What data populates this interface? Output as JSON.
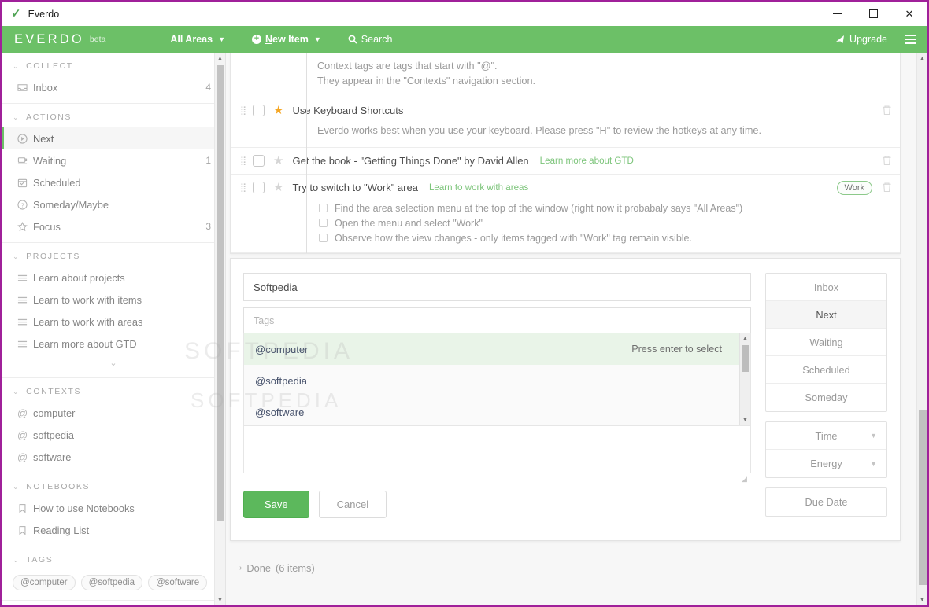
{
  "window": {
    "title": "Everdo",
    "check_icon": "✓",
    "minimize": "minimize-icon",
    "maximize": "maximize-icon",
    "close": "✕"
  },
  "appbar": {
    "brand": "EVERDO",
    "beta": "beta",
    "areas_label": "All Areas",
    "new_item_label": "New Item",
    "search_label": "Search",
    "upgrade_label": "Upgrade",
    "menu_icon": "hamburger-icon",
    "caret": "▼",
    "plus": "+",
    "search_icon": "🔍",
    "rocket_icon": "➤",
    "color": "#6cc067"
  },
  "sidebar": {
    "groups": [
      {
        "title": "COLLECT",
        "items": [
          {
            "label": "Inbox",
            "icon": "inbox-icon",
            "count": "4",
            "active": false
          }
        ]
      },
      {
        "title": "ACTIONS",
        "items": [
          {
            "label": "Next",
            "icon": "next-arrow-icon",
            "count": "",
            "active": true
          },
          {
            "label": "Waiting",
            "icon": "waiting-icon",
            "count": "1",
            "active": false
          },
          {
            "label": "Scheduled",
            "icon": "calendar-icon",
            "count": "",
            "active": false
          },
          {
            "label": "Someday/Maybe",
            "icon": "question-icon",
            "count": "",
            "active": false
          },
          {
            "label": "Focus",
            "icon": "star-icon",
            "count": "3",
            "active": false
          }
        ]
      },
      {
        "title": "PROJECTS",
        "items": [
          {
            "label": "Learn about projects",
            "icon": "list-icon",
            "count": "",
            "active": false
          },
          {
            "label": "Learn to work with items",
            "icon": "list-icon",
            "count": "",
            "active": false
          },
          {
            "label": "Learn to work with areas",
            "icon": "list-icon",
            "count": "",
            "active": false
          },
          {
            "label": "Learn more about GTD",
            "icon": "list-icon",
            "count": "",
            "active": false
          }
        ],
        "expand_icon": "chevron-down-icon"
      },
      {
        "title": "CONTEXTS",
        "items": [
          {
            "label": "computer",
            "icon": "at-icon",
            "count": "",
            "active": false
          },
          {
            "label": "softpedia",
            "icon": "at-icon",
            "count": "",
            "active": false
          },
          {
            "label": "software",
            "icon": "at-icon",
            "count": "",
            "active": false
          }
        ]
      },
      {
        "title": "NOTEBOOKS",
        "items": [
          {
            "label": "How to use Notebooks",
            "icon": "bookmark-icon",
            "count": "",
            "active": false
          },
          {
            "label": "Reading List",
            "icon": "bookmark-icon",
            "count": "",
            "active": false
          }
        ]
      },
      {
        "title": "TAGS",
        "chips": [
          "@computer",
          "@softpedia",
          "@software"
        ]
      }
    ]
  },
  "list": {
    "top_note": {
      "lines": [
        "Context tags are tags that start with \"@\".",
        "They appear in the \"Contexts\" navigation section."
      ]
    },
    "tasks": [
      {
        "title": "Use Keyboard Shortcuts",
        "starred": true,
        "link": "",
        "badge": "",
        "description": "Everdo works best when you use your keyboard. Please press \"H\" to review the hotkeys at any time.",
        "subtasks": []
      },
      {
        "title": "Get the book - \"Getting Things Done\" by David Allen",
        "starred": false,
        "link": "Learn more about GTD",
        "badge": "",
        "description": "",
        "subtasks": []
      },
      {
        "title": "Try to switch to \"Work\" area",
        "starred": false,
        "link": "Learn to work with areas",
        "badge": "Work",
        "description": "",
        "subtasks": [
          "Find the area selection menu at the top of the window (right now it probabaly says \"All Areas\")",
          "Open the menu and select \"Work\"",
          "Observe how the view changes - only items tagged with \"Work\" tag remain visible."
        ]
      }
    ],
    "done": {
      "label": "Done",
      "count": "(6 items)",
      "chevron": "›"
    }
  },
  "editor": {
    "title_value": "Softpedia",
    "title_placeholder": "",
    "tags_value": "",
    "tags_placeholder": "Tags",
    "note_value": "",
    "suggestions": [
      {
        "label": "@computer",
        "hint": "Press enter to select",
        "selected": true
      },
      {
        "label": "@softpedia",
        "hint": "",
        "selected": false
      },
      {
        "label": "@software",
        "hint": "",
        "selected": false
      }
    ],
    "save_label": "Save",
    "cancel_label": "Cancel",
    "list_buttons": [
      {
        "label": "Inbox",
        "active": false,
        "caret": false
      },
      {
        "label": "Next",
        "active": true,
        "caret": false
      },
      {
        "label": "Waiting",
        "active": false,
        "caret": false
      },
      {
        "label": "Scheduled",
        "active": false,
        "caret": false
      },
      {
        "label": "Someday",
        "active": false,
        "caret": false
      }
    ],
    "meta_buttons": [
      {
        "label": "Time",
        "active": false,
        "caret": true
      },
      {
        "label": "Energy",
        "active": false,
        "caret": true
      }
    ],
    "due_button": {
      "label": "Due Date",
      "active": false,
      "caret": false
    }
  },
  "watermark": "SOFTPEDIA"
}
